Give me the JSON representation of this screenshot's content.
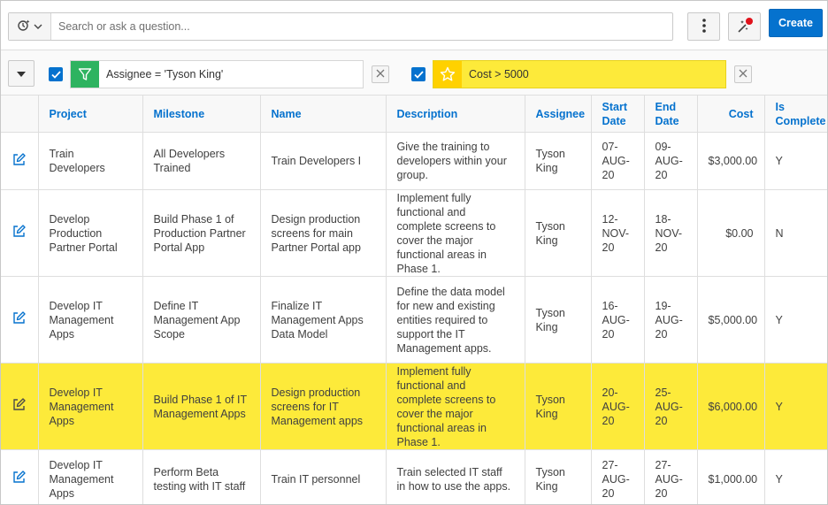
{
  "search": {
    "placeholder": "Search or ask a question..."
  },
  "toolbar": {
    "create_label": "Create"
  },
  "filters": [
    {
      "text": "Assignee = 'Tyson King'",
      "type": "filter",
      "checked": true,
      "color": "#2eb360"
    },
    {
      "text": "Cost > 5000",
      "type": "highlight",
      "checked": true,
      "color": "#ffd100",
      "highlight_color": "#fdea3a"
    }
  ],
  "colors": {
    "accent": "#0572ce",
    "highlight": "#fdea3a"
  },
  "table": {
    "columns": [
      "Project",
      "Milestone",
      "Name",
      "Description",
      "Assignee",
      "Start Date",
      "End Date",
      "Cost",
      "Is Complete"
    ],
    "rows": [
      {
        "project": "Train Developers",
        "milestone": "All Developers Trained",
        "name": "Train Developers I",
        "description": "Give the training to developers within your group.",
        "assignee": "Tyson King",
        "start": "07-AUG-20",
        "end": "09-AUG-20",
        "cost": "$3,000.00",
        "complete": "Y",
        "highlighted": false
      },
      {
        "project": "Develop Production Partner Portal",
        "milestone": "Build Phase 1 of Production Partner Portal App",
        "name": "Design production screens for main Partner Portal app",
        "description": "Implement fully functional and complete screens to cover the major functional areas in Phase 1.",
        "assignee": "Tyson King",
        "start": "12-NOV-20",
        "end": "18-NOV-20",
        "cost": "$0.00",
        "complete": "N",
        "highlighted": false
      },
      {
        "project": "Develop IT Management Apps",
        "milestone": "Define IT Management App Scope",
        "name": "Finalize IT Management Apps Data Model",
        "description": "Define the data model for new and existing entities required to support the IT Management apps.",
        "assignee": "Tyson King",
        "start": "16-AUG-20",
        "end": "19-AUG-20",
        "cost": "$5,000.00",
        "complete": "Y",
        "highlighted": false
      },
      {
        "project": "Develop IT Management Apps",
        "milestone": "Build Phase 1 of IT Management Apps",
        "name": "Design production screens for IT Management apps",
        "description": "Implement fully functional and complete screens to cover the major functional areas in Phase 1.",
        "assignee": "Tyson King",
        "start": "20-AUG-20",
        "end": "25-AUG-20",
        "cost": "$6,000.00",
        "complete": "Y",
        "highlighted": true
      },
      {
        "project": "Develop IT Management Apps",
        "milestone": "Perform Beta testing with IT staff",
        "name": "Train IT personnel",
        "description": "Train selected IT staff in how to use the apps.",
        "assignee": "Tyson King",
        "start": "27-AUG-20",
        "end": "27-AUG-20",
        "cost": "$1,000.00",
        "complete": "Y",
        "highlighted": false
      }
    ]
  }
}
